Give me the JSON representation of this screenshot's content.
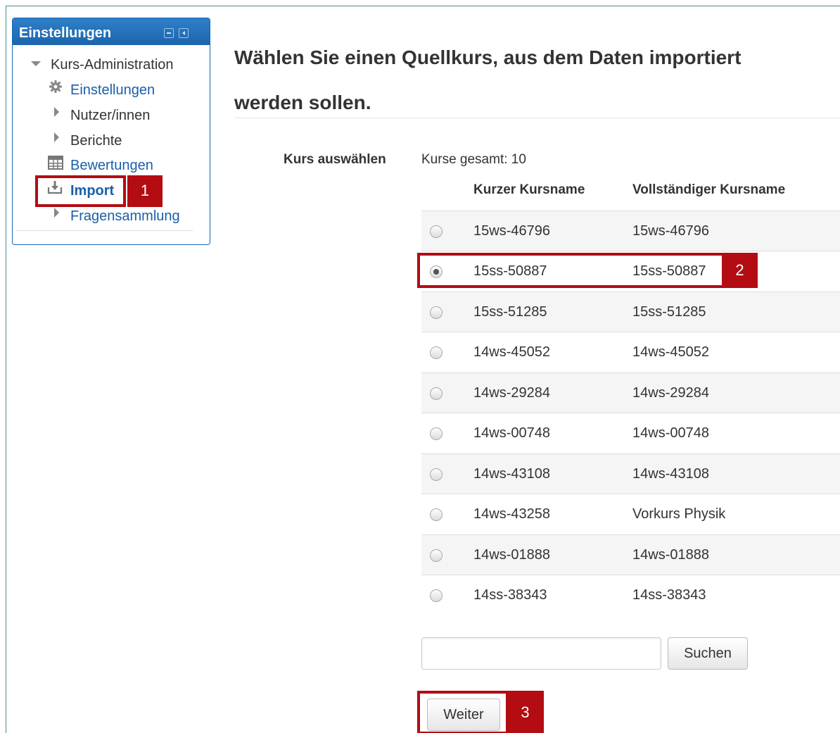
{
  "sidebar": {
    "title": "Einstellungen",
    "items": [
      {
        "label": "Kurs-Administration",
        "icon": "triangle-down-icon",
        "link": false
      },
      {
        "label": "Einstellungen",
        "icon": "gear-icon",
        "link": true
      },
      {
        "label": "Nutzer/innen",
        "icon": "triangle-right-icon",
        "link": false
      },
      {
        "label": "Berichte",
        "icon": "triangle-right-icon",
        "link": false
      },
      {
        "label": "Bewertungen",
        "icon": "table-icon",
        "link": true
      },
      {
        "label": "Import",
        "icon": "import-icon",
        "link": true,
        "active": true
      },
      {
        "label": "Fragensammlung",
        "icon": "triangle-right-icon",
        "link": true
      }
    ]
  },
  "callouts": [
    "1",
    "2",
    "3"
  ],
  "main": {
    "heading_line1": "Wählen Sie einen Quellkurs, aus dem Daten importiert",
    "heading_line2": "werden sollen.",
    "field_label": "Kurs auswählen",
    "total": "Kurse gesamt: 10",
    "columns": [
      "Kurzer Kursname",
      "Vollständiger Kursname"
    ],
    "rows": [
      {
        "short": "15ws-46796",
        "full": "15ws-46796",
        "selected": false
      },
      {
        "short": "15ss-50887",
        "full": "15ss-50887",
        "selected": true
      },
      {
        "short": "15ss-51285",
        "full": "15ss-51285",
        "selected": false
      },
      {
        "short": "14ws-45052",
        "full": "14ws-45052",
        "selected": false
      },
      {
        "short": "14ws-29284",
        "full": "14ws-29284",
        "selected": false
      },
      {
        "short": "14ws-00748",
        "full": "14ws-00748",
        "selected": false
      },
      {
        "short": "14ws-43108",
        "full": "14ws-43108",
        "selected": false
      },
      {
        "short": "14ws-43258",
        "full": "Vorkurs Physik",
        "selected": false
      },
      {
        "short": "14ws-01888",
        "full": "14ws-01888",
        "selected": false
      },
      {
        "short": "14ss-38343",
        "full": "14ss-38343",
        "selected": false
      }
    ],
    "search_value": "",
    "search_button": "Suchen",
    "next_button": "Weiter"
  },
  "colors": {
    "header_blue": "#1c65ad",
    "link_blue": "#1a5fa8",
    "callout_red": "#b30c12"
  }
}
